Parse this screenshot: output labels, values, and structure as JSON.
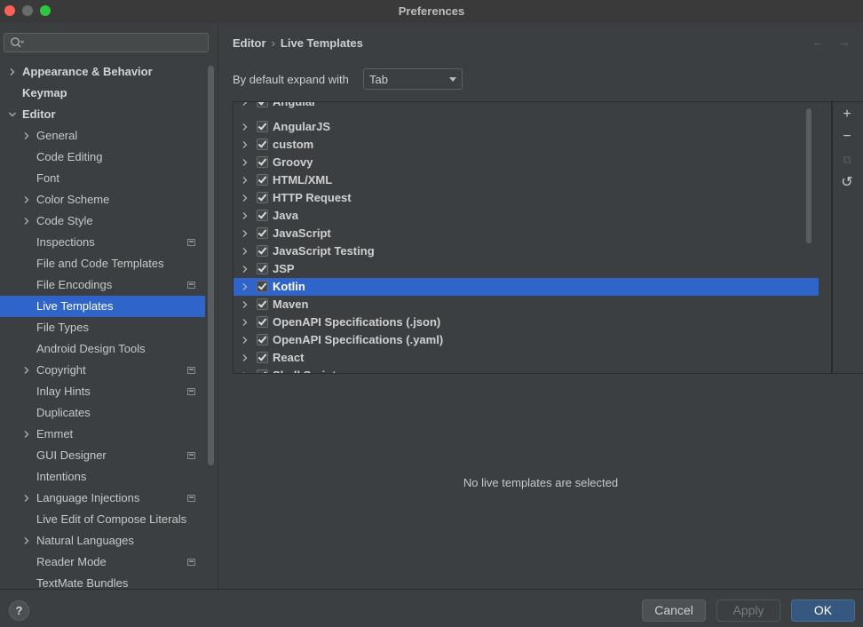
{
  "window": {
    "title": "Preferences"
  },
  "sidebar": {
    "search_placeholder": "",
    "items": [
      {
        "label": "Appearance & Behavior",
        "level": 0,
        "expandable": true,
        "expanded": false,
        "bold": true,
        "project_icon": false
      },
      {
        "label": "Keymap",
        "level": 0,
        "expandable": false,
        "bold": true,
        "project_icon": false
      },
      {
        "label": "Editor",
        "level": 0,
        "expandable": true,
        "expanded": true,
        "bold": true,
        "project_icon": false
      },
      {
        "label": "General",
        "level": 1,
        "expandable": true,
        "expanded": false,
        "project_icon": false
      },
      {
        "label": "Code Editing",
        "level": 1,
        "expandable": false,
        "project_icon": false
      },
      {
        "label": "Font",
        "level": 1,
        "expandable": false,
        "project_icon": false
      },
      {
        "label": "Color Scheme",
        "level": 1,
        "expandable": true,
        "expanded": false,
        "project_icon": false
      },
      {
        "label": "Code Style",
        "level": 1,
        "expandable": true,
        "expanded": false,
        "project_icon": false
      },
      {
        "label": "Inspections",
        "level": 1,
        "expandable": false,
        "project_icon": true
      },
      {
        "label": "File and Code Templates",
        "level": 1,
        "expandable": false,
        "project_icon": false
      },
      {
        "label": "File Encodings",
        "level": 1,
        "expandable": false,
        "project_icon": true
      },
      {
        "label": "Live Templates",
        "level": 1,
        "expandable": false,
        "project_icon": false,
        "selected": true
      },
      {
        "label": "File Types",
        "level": 1,
        "expandable": false,
        "project_icon": false
      },
      {
        "label": "Android Design Tools",
        "level": 1,
        "expandable": false,
        "project_icon": false
      },
      {
        "label": "Copyright",
        "level": 1,
        "expandable": true,
        "expanded": false,
        "project_icon": true
      },
      {
        "label": "Inlay Hints",
        "level": 1,
        "expandable": false,
        "project_icon": true
      },
      {
        "label": "Duplicates",
        "level": 1,
        "expandable": false,
        "project_icon": false
      },
      {
        "label": "Emmet",
        "level": 1,
        "expandable": true,
        "expanded": false,
        "project_icon": false
      },
      {
        "label": "GUI Designer",
        "level": 1,
        "expandable": false,
        "project_icon": true
      },
      {
        "label": "Intentions",
        "level": 1,
        "expandable": false,
        "project_icon": false
      },
      {
        "label": "Language Injections",
        "level": 1,
        "expandable": true,
        "expanded": false,
        "project_icon": true
      },
      {
        "label": "Live Edit of Compose Literals",
        "level": 1,
        "expandable": false,
        "project_icon": false
      },
      {
        "label": "Natural Languages",
        "level": 1,
        "expandable": true,
        "expanded": false,
        "project_icon": false
      },
      {
        "label": "Reader Mode",
        "level": 1,
        "expandable": false,
        "project_icon": true
      },
      {
        "label": "TextMate Bundles",
        "level": 1,
        "expandable": false,
        "project_icon": false
      }
    ]
  },
  "main": {
    "breadcrumb": {
      "parent": "Editor",
      "separator": "›",
      "current": "Live Templates"
    },
    "nav": {
      "back": "←",
      "forward": "→"
    },
    "expand_with": {
      "label": "By default expand with",
      "value": "Tab"
    },
    "template_groups": [
      {
        "label": "Angular",
        "checked": true,
        "partial": true
      },
      {
        "label": "AngularJS",
        "checked": true
      },
      {
        "label": "custom",
        "checked": true
      },
      {
        "label": "Groovy",
        "checked": true
      },
      {
        "label": "HTML/XML",
        "checked": true
      },
      {
        "label": "HTTP Request",
        "checked": true
      },
      {
        "label": "Java",
        "checked": true
      },
      {
        "label": "JavaScript",
        "checked": true
      },
      {
        "label": "JavaScript Testing",
        "checked": true
      },
      {
        "label": "JSP",
        "checked": true
      },
      {
        "label": "Kotlin",
        "checked": true,
        "selected": true
      },
      {
        "label": "Maven",
        "checked": true
      },
      {
        "label": "OpenAPI Specifications (.json)",
        "checked": true
      },
      {
        "label": "OpenAPI Specifications (.yaml)",
        "checked": true
      },
      {
        "label": "React",
        "checked": true
      },
      {
        "label": "Shell Script",
        "checked": true
      }
    ],
    "toolbar": {
      "add": "+",
      "remove": "−",
      "copy": "⧉",
      "restore": "↺"
    },
    "empty_message": "No live templates are selected"
  },
  "footer": {
    "help": "?",
    "cancel": "Cancel",
    "apply": "Apply",
    "ok": "OK"
  },
  "colors": {
    "selection": "#2f65ca",
    "background": "#3c3f41",
    "ok_button": "#365880"
  }
}
